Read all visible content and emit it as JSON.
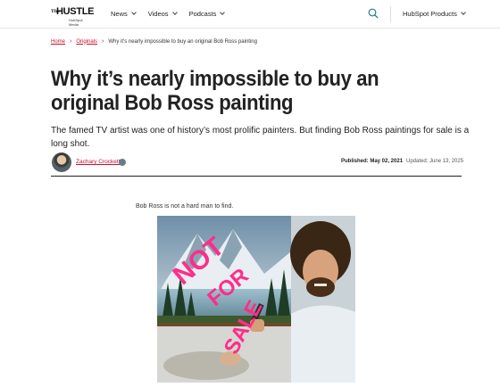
{
  "logo": {
    "the": "The",
    "name": "HUSTLE",
    "tagline": "HubSpot Media"
  },
  "nav": {
    "items": [
      {
        "label": "News"
      },
      {
        "label": "Videos"
      },
      {
        "label": "Podcasts"
      }
    ],
    "products_label": "HubSpot Products"
  },
  "breadcrumb": {
    "home": "Home",
    "section": "Originals",
    "current": "Why it's nearly impossible to buy an original Bob Ross painting",
    "separator": "›"
  },
  "article": {
    "title": "Why it’s nearly impossible to buy an original Bob Ross painting",
    "subtitle": "The famed TV artist was one of history’s most prolific painters. But finding Bob Ross paintings for sale is a long shot.",
    "author": "Zachary Crockett",
    "published": "Published: May 02, 2021",
    "updated": "Updated: June 13, 2025",
    "lead": "Bob Ross is not a hard man to find.",
    "image_overlay": [
      "NOT",
      "FOR",
      "SALE"
    ]
  },
  "colors": {
    "accent": "#c8102e",
    "overlay_pink": "#ff2d8a"
  }
}
